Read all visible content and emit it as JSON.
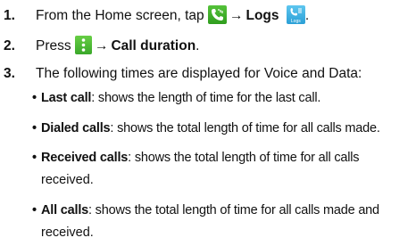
{
  "steps": [
    {
      "num": "1.",
      "pre": "From the Home screen, tap",
      "arrow": "→",
      "target": "Logs",
      "icons": [
        "phone-icon",
        "logs-icon"
      ],
      "logs_icon_label": "Logs"
    },
    {
      "num": "2.",
      "pre": "Press",
      "arrow": "→",
      "target": "Call duration",
      "icons": [
        "menu-icon"
      ]
    },
    {
      "num": "3.",
      "text": "The following times are displayed for Voice and Data:"
    }
  ],
  "bullets": [
    {
      "term": "Last call",
      "desc": ": shows the length of time for the last call."
    },
    {
      "term": "Dialed calls",
      "desc": ": shows the total length of time for all calls made."
    },
    {
      "term": "Received calls",
      "desc": ": shows the total length of time for all calls",
      "cont": "received."
    },
    {
      "term": "All calls",
      "desc": ": shows the total length of time for all calls made and",
      "cont": "received."
    }
  ],
  "bullet_char": "•",
  "colors": {
    "phone_icon": "#3fae2a",
    "logs_icon": "#38a9df",
    "menu_icon": "#4cbb36"
  }
}
